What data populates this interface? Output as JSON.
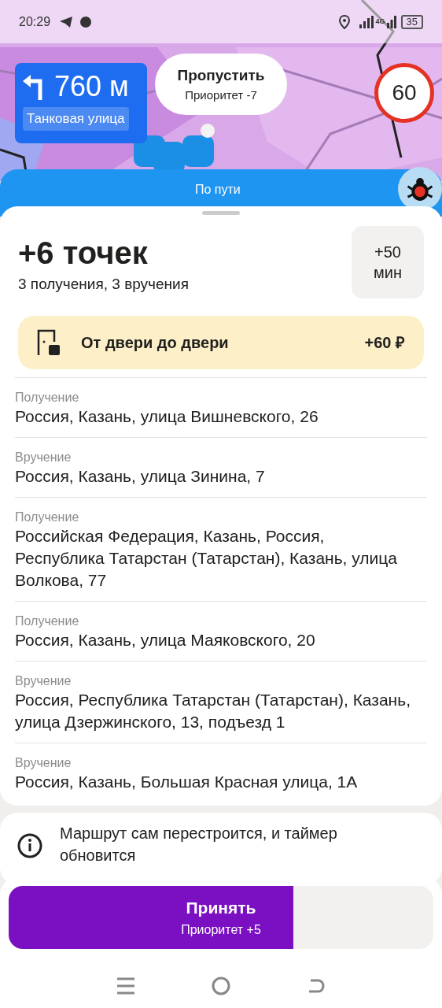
{
  "status_bar": {
    "time": "20:29",
    "network": "4G",
    "battery": "35"
  },
  "navigation": {
    "distance": "760 м",
    "street": "Танковая улица"
  },
  "skip_button": {
    "label": "Пропустить",
    "priority": "Приоритет -7"
  },
  "speed_limit": "60",
  "route_banner": "По пути",
  "offer": {
    "title": "+6 точек",
    "subtitle": "3 получения, 3 вручения",
    "time_badge": {
      "value": "+50",
      "unit": "мин"
    }
  },
  "bonus": {
    "label": "От двери до двери",
    "amount": "+60 ₽"
  },
  "stops": [
    {
      "type": "Получение",
      "address": "Россия, Казань, улица Вишневского, 26"
    },
    {
      "type": "Вручение",
      "address": "Россия, Казань, улица Зинина, 7"
    },
    {
      "type": "Получение",
      "address": "Российская Федерация, Казань, Россия, Республика Татарстан (Татарстан), Казань, улица Волкова, 77"
    },
    {
      "type": "Получение",
      "address": "Россия, Казань, улица Маяковского, 20"
    },
    {
      "type": "Вручение",
      "address": "Россия, Республика Татарстан (Татарстан), Казань, улица Дзержинского, 13, подъезд 1"
    },
    {
      "type": "Вручение",
      "address": "Россия, Казань, Большая Красная улица, 1А"
    }
  ],
  "info": "Маршрут сам перестроится, и таймер обновится",
  "accept_button": {
    "label": "Принять",
    "priority": "Приоритет +5",
    "level": 0.67
  }
}
